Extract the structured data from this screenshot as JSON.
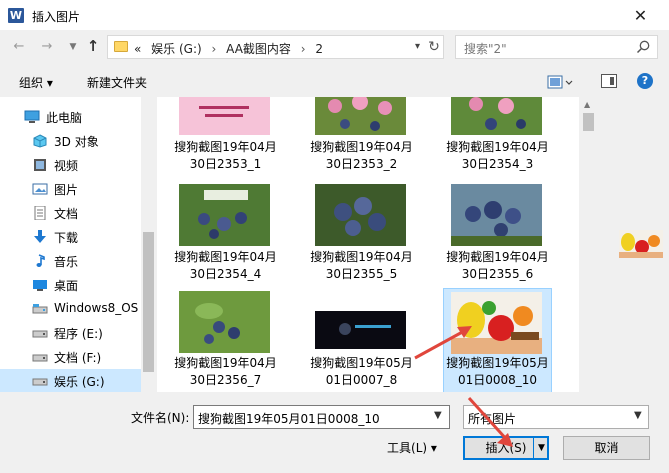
{
  "window": {
    "title": "插入图片",
    "app_icon": "W"
  },
  "address": {
    "history_marker": "«",
    "crumbs": [
      "娱乐 (G:)",
      "AA截图内容",
      "2"
    ],
    "separator": "›"
  },
  "search": {
    "placeholder": "搜索\"2\""
  },
  "toolbar": {
    "organize": "组织 ▾",
    "new_folder": "新建文件夹"
  },
  "nav": {
    "items": [
      {
        "label": "此电脑",
        "icon": "computer-icon"
      },
      {
        "label": "3D 对象",
        "icon": "3d-objects-icon"
      },
      {
        "label": "视频",
        "icon": "video-icon"
      },
      {
        "label": "图片",
        "icon": "pictures-icon"
      },
      {
        "label": "文档",
        "icon": "documents-icon"
      },
      {
        "label": "下载",
        "icon": "download-icon"
      },
      {
        "label": "音乐",
        "icon": "music-icon"
      },
      {
        "label": "桌面",
        "icon": "desktop-icon"
      },
      {
        "label": "Windows8_OS",
        "icon": "drive-icon"
      },
      {
        "label": "程序 (E:)",
        "icon": "drive-icon"
      },
      {
        "label": "文档 (F:)",
        "icon": "drive-icon"
      },
      {
        "label": "娱乐 (G:)",
        "icon": "drive-icon",
        "selected": true
      }
    ]
  },
  "files": [
    {
      "name": "搜狗截图19年04月30日2353_1",
      "thumb": "banner"
    },
    {
      "name": "搜狗截图19年04月30日2353_2",
      "thumb": "berries-flowers"
    },
    {
      "name": "搜狗截图19年04月30日2354_3",
      "thumb": "berries-flowers"
    },
    {
      "name": "搜狗截图19年04月30日2354_4",
      "thumb": "berries-banner"
    },
    {
      "name": "搜狗截图19年04月30日2355_5",
      "thumb": "berries-dark"
    },
    {
      "name": "搜狗截图19年04月30日2355_6",
      "thumb": "berries-dark"
    },
    {
      "name": "搜狗截图19年04月30日2356_7",
      "thumb": "berries-green"
    },
    {
      "name": "搜狗截图19年05月01日0007_8",
      "thumb": "dark"
    },
    {
      "name": "搜狗截图19年05月01日0008_10",
      "thumb": "fruit",
      "selected": true
    }
  ],
  "bottom": {
    "filename_label": "文件名(N):",
    "filename_value": "搜狗截图19年05月01日0008_10",
    "filetype_value": "所有图片",
    "tools": "工具(L)  ▾",
    "insert": "插入(S)",
    "cancel": "取消"
  },
  "colors": {
    "selection": "#cce8ff",
    "accent": "#0078d7",
    "arrow": "#e0463c"
  }
}
